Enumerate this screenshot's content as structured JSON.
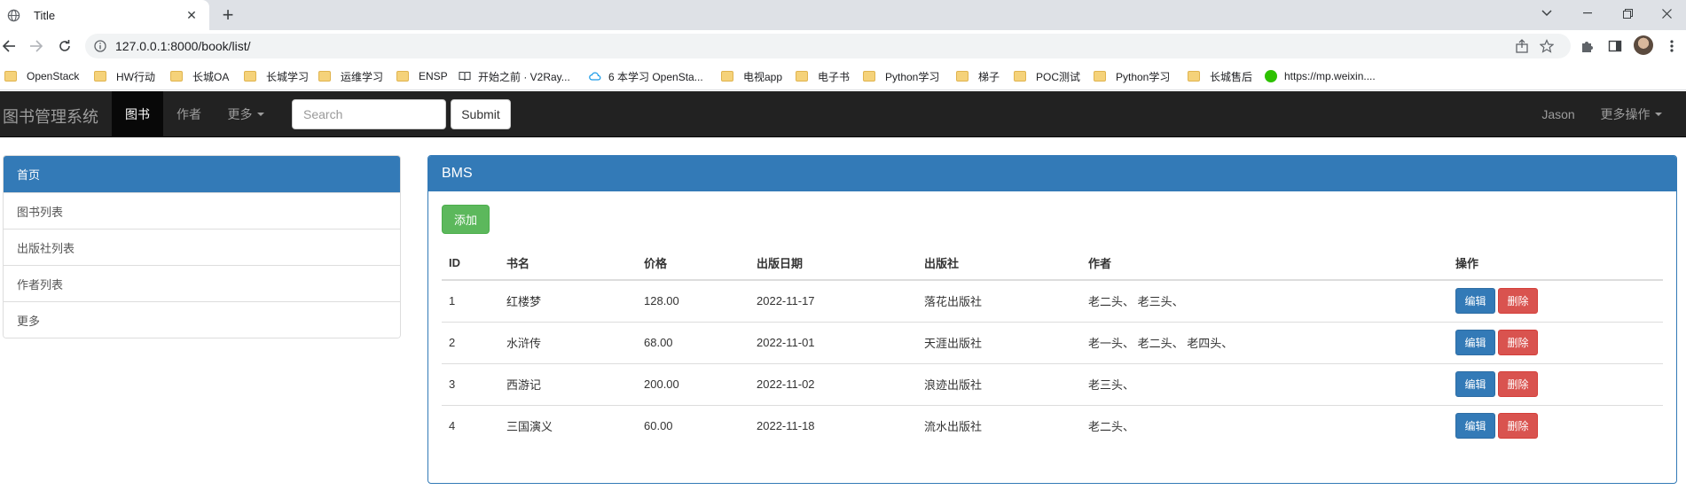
{
  "browser": {
    "tab_title": "Title",
    "url": "127.0.0.1:8000/book/list/",
    "bookmarks": [
      {
        "label": "OpenStack",
        "icon": "folder-icon"
      },
      {
        "label": "HW行动",
        "icon": "folder-icon"
      },
      {
        "label": "长城OA",
        "icon": "folder-icon"
      },
      {
        "label": "长城学习",
        "icon": "folder-icon"
      },
      {
        "label": "运维学习",
        "icon": "folder-icon"
      },
      {
        "label": "ENSP",
        "icon": "folder-icon"
      },
      {
        "label": "开始之前 · V2Ray...",
        "icon": "book-icon"
      },
      {
        "label": "6 本学习 OpenSta...",
        "icon": "cloud-icon"
      },
      {
        "label": "电视app",
        "icon": "folder-icon"
      },
      {
        "label": "电子书",
        "icon": "folder-icon"
      },
      {
        "label": "Python学习",
        "icon": "folder-icon"
      },
      {
        "label": "梯子",
        "icon": "folder-icon"
      },
      {
        "label": "POC测试",
        "icon": "folder-icon"
      },
      {
        "label": "Python学习",
        "icon": "folder-icon"
      },
      {
        "label": "长城售后",
        "icon": "folder-icon"
      },
      {
        "label": "https://mp.weixin....",
        "icon": "wechat-icon"
      }
    ]
  },
  "navbar": {
    "brand": "图书管理系统",
    "items": [
      {
        "label": "图书",
        "active": true
      },
      {
        "label": "作者",
        "active": false
      },
      {
        "label": "更多",
        "active": false
      }
    ],
    "search_placeholder": "Search",
    "submit_label": "Submit",
    "user": "Jason",
    "more_ops": "更多操作"
  },
  "sidebar": {
    "items": [
      {
        "label": "首页",
        "active": true
      },
      {
        "label": "图书列表"
      },
      {
        "label": "出版社列表"
      },
      {
        "label": "作者列表"
      },
      {
        "label": "更多"
      }
    ]
  },
  "panel": {
    "title": "BMS",
    "add_label": "添加",
    "columns": [
      "ID",
      "书名",
      "价格",
      "出版日期",
      "出版社",
      "作者",
      "操作"
    ],
    "rows": [
      {
        "id": "1",
        "name": "红楼梦",
        "price": "128.00",
        "date": "2022-11-17",
        "publisher": "落花出版社",
        "authors": "老二头、 老三头、"
      },
      {
        "id": "2",
        "name": "水浒传",
        "price": "68.00",
        "date": "2022-11-01",
        "publisher": "天涯出版社",
        "authors": "老一头、 老二头、 老四头、"
      },
      {
        "id": "3",
        "name": "西游记",
        "price": "200.00",
        "date": "2022-11-02",
        "publisher": "浪迹出版社",
        "authors": "老三头、"
      },
      {
        "id": "4",
        "name": "三国演义",
        "price": "60.00",
        "date": "2022-11-18",
        "publisher": "流水出版社",
        "authors": "老二头、"
      }
    ],
    "edit_label": "编辑",
    "delete_label": "删除"
  },
  "colors": {
    "navbar_bg": "#222222",
    "primary": "#337ab7",
    "success": "#5cb85c",
    "danger": "#d9534f"
  }
}
